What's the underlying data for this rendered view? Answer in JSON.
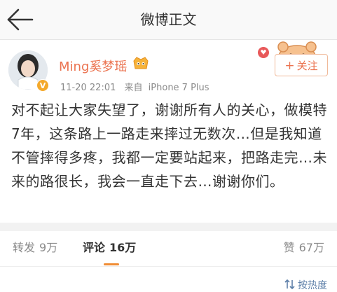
{
  "nav": {
    "title": "微博正文",
    "back_icon": "back-arrow-icon"
  },
  "post": {
    "author": {
      "name": "Ming奚梦瑶",
      "verified": true,
      "avatar_icon": "avatar"
    },
    "time": "11-20 22:01",
    "source_prefix": "来自",
    "source": "iPhone 7 Plus",
    "follow_label": "关注",
    "follow_plus": "+",
    "text": "对不起让大家失望了，谢谢所有人的关心，做模特7年，这条路上一路走来摔过无数次…但是我知道不管摔得多疼，我都一定要站起来，把路走完…未来的路很长，我会一直走下去…谢谢你们。"
  },
  "tabs": {
    "repost": {
      "label": "转发",
      "count": "9万"
    },
    "comment": {
      "label": "评论",
      "count": "16万"
    },
    "like": {
      "label": "赞",
      "count": "67万"
    }
  },
  "sort": {
    "label": "按热度"
  },
  "colors": {
    "accent": "#eb7350",
    "tab_indicator": "#f08c34",
    "link": "#5d7fa8",
    "muted": "#8a8a8a",
    "text": "#333333"
  }
}
